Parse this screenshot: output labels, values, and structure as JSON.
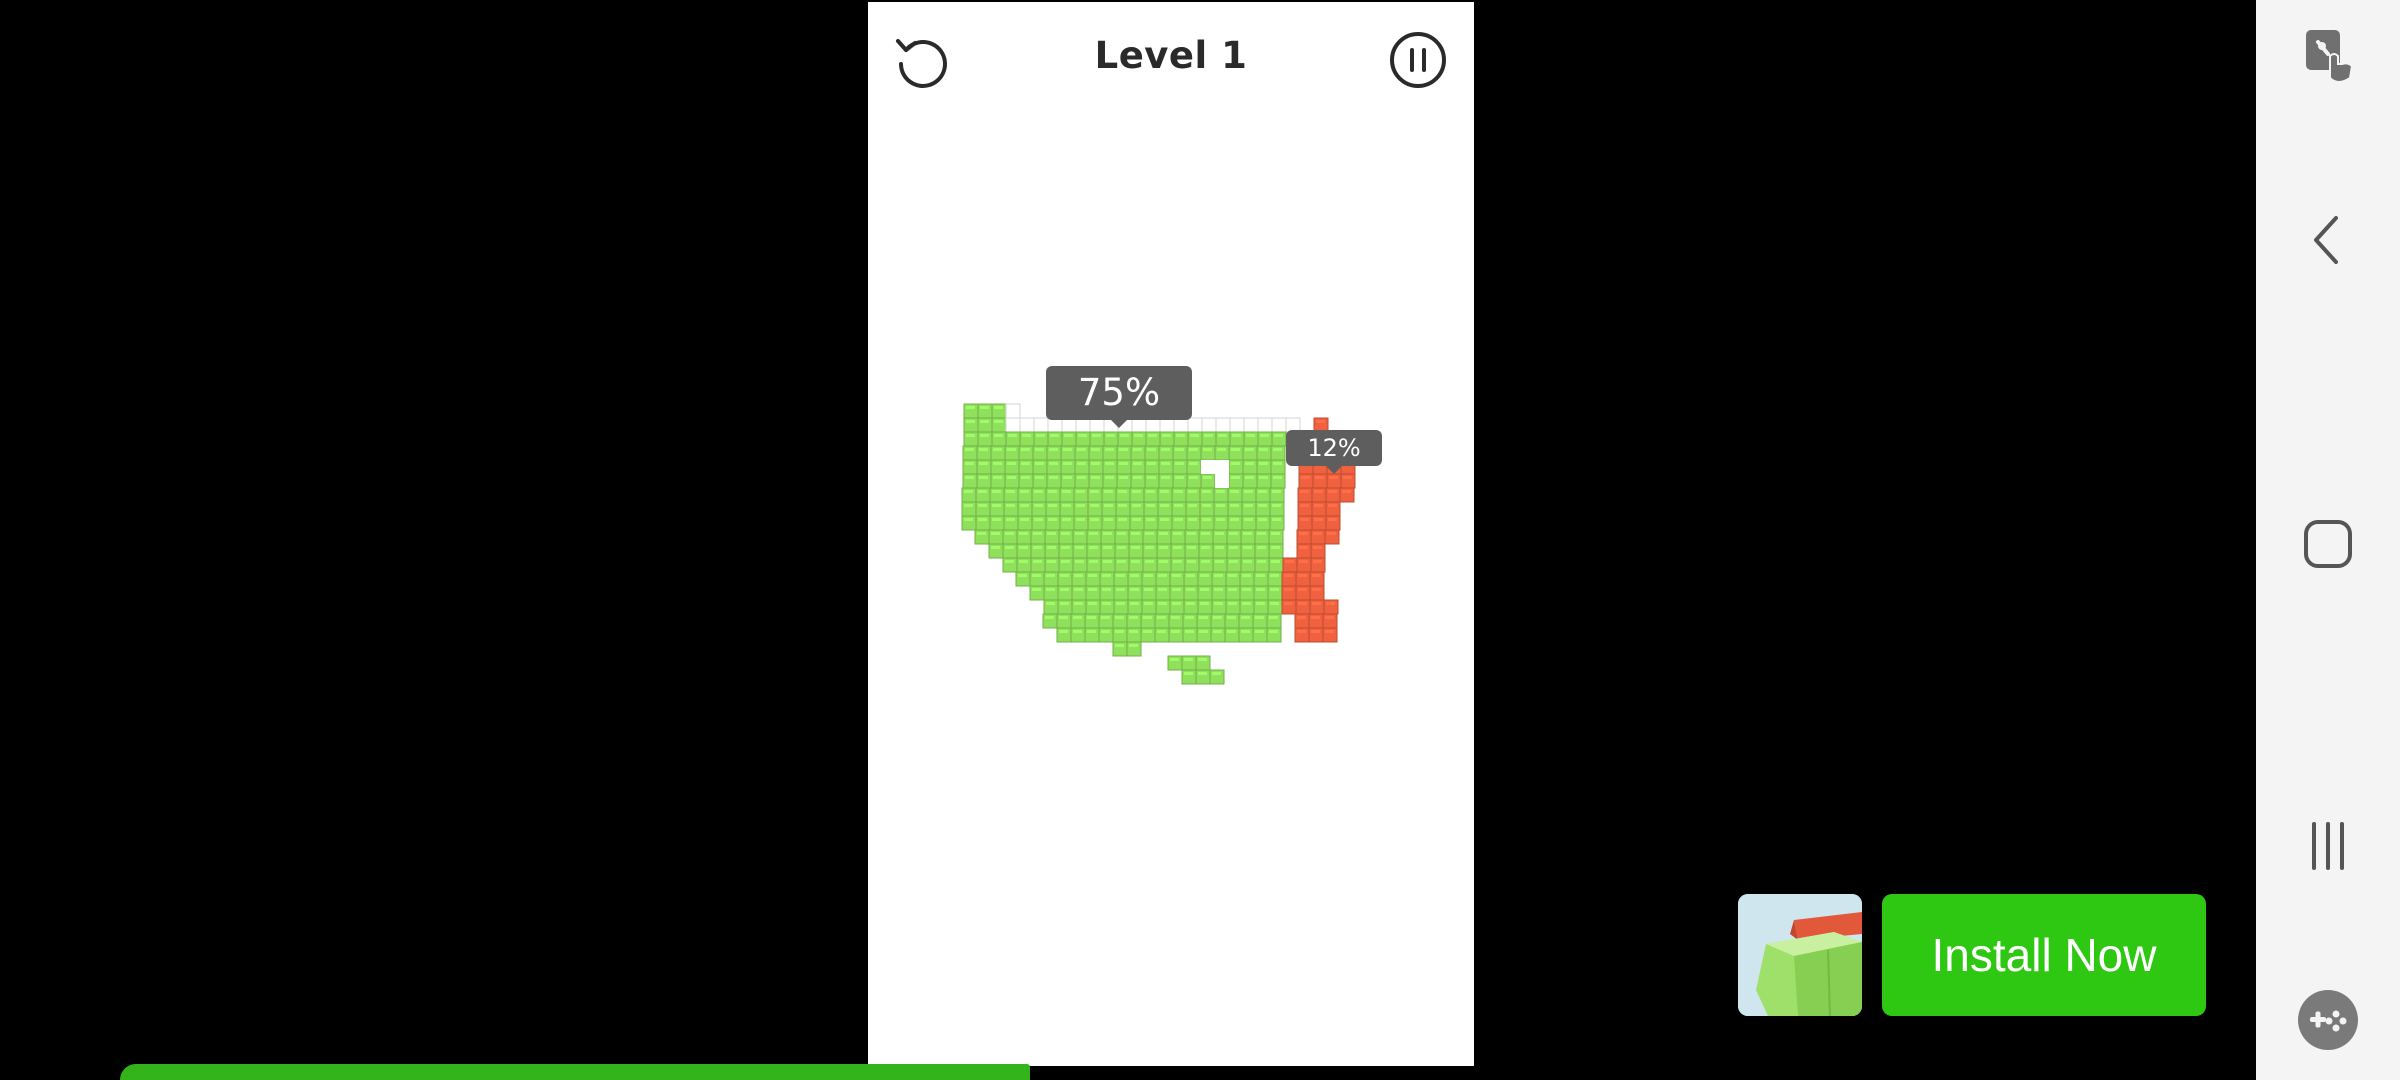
{
  "game": {
    "level_title": "Level 1",
    "green_percent": "75%",
    "red_percent": "12%"
  },
  "ad": {
    "install_label": "Install Now"
  },
  "progress": {
    "fraction": 0.65
  },
  "icons": {
    "restart": "restart-icon",
    "pause": "pause-icon",
    "screen_touch": "screen-touch-icon",
    "back": "back-icon",
    "home": "home-icon",
    "recents": "recents-icon",
    "game_tools": "gamepad-icon"
  },
  "colors": {
    "green_cube": "#8fe05c",
    "red_cube": "#f0623f",
    "install_button": "#2ec712",
    "progress_bar": "#33b41a",
    "bubble": "#5e5e5e"
  }
}
